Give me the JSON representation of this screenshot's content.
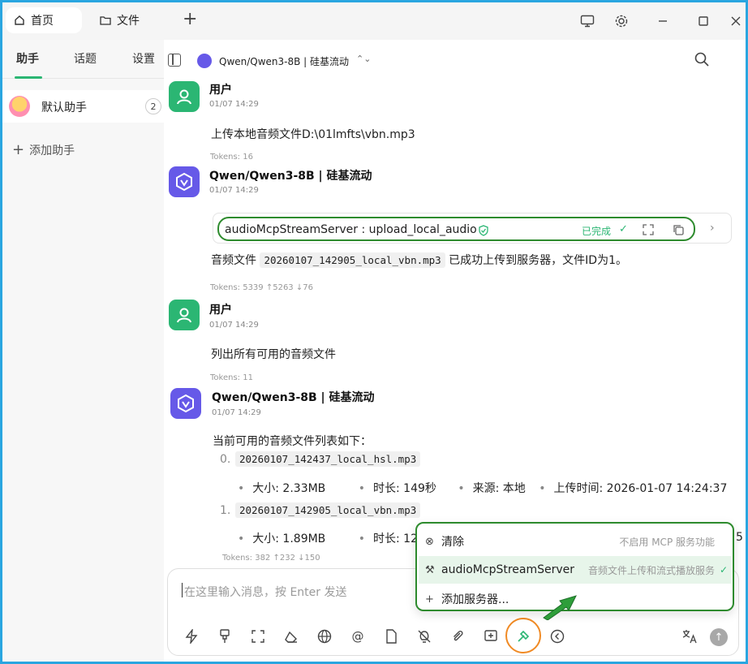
{
  "titlebar": {
    "tabs": [
      {
        "label": "首页",
        "icon": "home-icon"
      },
      {
        "label": "文件",
        "icon": "folder-icon"
      }
    ],
    "new_tab": "+",
    "window_controls": [
      "monitor-icon",
      "settings-icon",
      "minimize-icon",
      "maximize-icon",
      "close-icon"
    ]
  },
  "sidebar": {
    "tabs": [
      "助手",
      "话题",
      "设置"
    ],
    "assistants": [
      {
        "name": "默认助手",
        "count": "2"
      }
    ],
    "add_label": "添加助手"
  },
  "header": {
    "model": "Qwen/Qwen3-8B | 硅基流动"
  },
  "messages": [
    {
      "role": "user",
      "sender": "用户",
      "time": "01/07 14:29",
      "text": "上传本地音频文件D:\\01lmfts\\vbn.mp3",
      "tokens": "Tokens: 16"
    },
    {
      "role": "assistant",
      "sender": "Qwen/Qwen3-8B | 硅基流动",
      "time": "01/07 14:29",
      "tool_call": {
        "name": "audioMcpStreamServer : upload_local_audio",
        "status": "已完成"
      },
      "text_before": "音频文件",
      "code": "20260107_142905_local_vbn.mp3",
      "text_after": "已成功上传到服务器，文件ID为1。",
      "tokens": "Tokens: 5339 ↑5263 ↓76"
    },
    {
      "role": "user",
      "sender": "用户",
      "time": "01/07 14:29",
      "text": "列出所有可用的音频文件",
      "tokens": "Tokens: 11"
    },
    {
      "role": "assistant",
      "sender": "Qwen/Qwen3-8B | 硅基流动",
      "time": "01/07 14:29",
      "intro": "当前可用的音频文件列表如下：",
      "files": [
        {
          "index": "0.",
          "name": "20260107_142437_local_hsl.mp3",
          "size": "大小: 2.33MB",
          "duration": "时长: 149秒",
          "source": "来源: 本地",
          "uploaded": "上传时间: 2026-01-07 14:24:37"
        },
        {
          "index": "1.",
          "name": "20260107_142905_local_vbn.mp3",
          "size": "大小: 1.89MB",
          "duration": "时长: 12"
        }
      ],
      "tokens": "Tokens: 382 ↑232 ↓150"
    }
  ],
  "input": {
    "placeholder": "在这里输入消息，按 Enter 发送"
  },
  "mcp_menu": {
    "items": [
      {
        "label": "清除",
        "desc": "不启用 MCP 服务功能",
        "icon": "clear-icon"
      },
      {
        "label": "audioMcpStreamServer",
        "desc": "音频文件上传和流式播放服务",
        "icon": "hammer-icon",
        "selected": true
      },
      {
        "label": "添加服务器...",
        "desc": "",
        "icon": "plus-icon"
      }
    ],
    "trailing": "5"
  },
  "colors": {
    "accent": "#2bb673",
    "model_purple": "#6659e8",
    "highlight_green": "#2e8b2e",
    "highlight_orange": "#f08a24"
  }
}
